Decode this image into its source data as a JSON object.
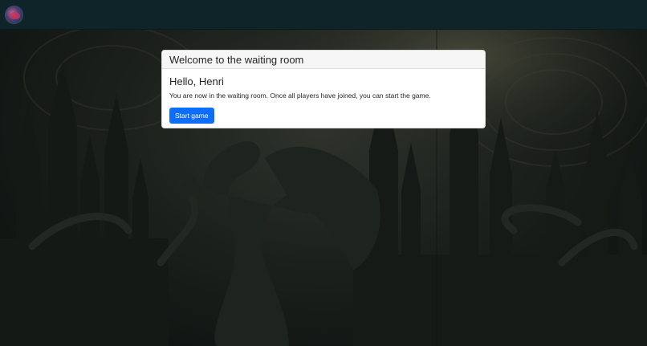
{
  "navbar": {
    "logo_icon": "game-logo-icon"
  },
  "card": {
    "header": "Welcome to the waiting room",
    "greeting": "Hello, Henri",
    "message": "You are now in the waiting room. Once all players have joined, you can start the game.",
    "start_button_label": "Start game"
  },
  "colors": {
    "navbar": "#0f2429",
    "primary_button": "#0d6efd",
    "card_header": "#f6f6f6"
  },
  "background": {
    "description_icon": "dragon-castle-background"
  }
}
